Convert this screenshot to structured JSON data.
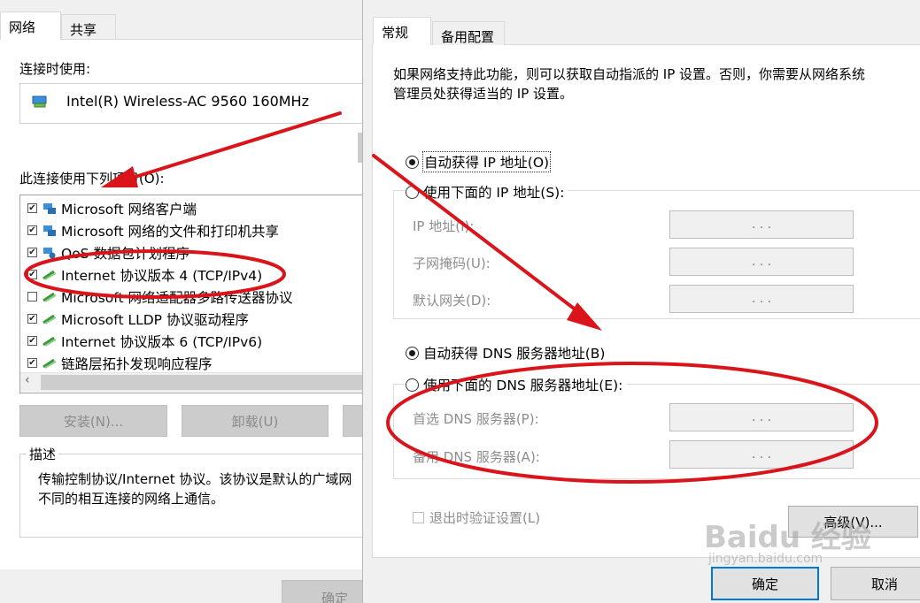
{
  "left_dialog": {
    "tabs": [
      "网络",
      "共享"
    ],
    "connect_using_label": "连接时使用:",
    "adapter_name": "Intel(R) Wireless-AC 9560 160MHz",
    "components_label": "此连接使用下列项目(O):",
    "components": [
      {
        "label": "Microsoft 网络客户端",
        "checked": true
      },
      {
        "label": "Microsoft 网络的文件和打印机共享",
        "checked": true
      },
      {
        "label": "QoS 数据包计划程序",
        "checked": true
      },
      {
        "label": "Internet 协议版本 4 (TCP/IPv4)",
        "checked": true
      },
      {
        "label": "Microsoft 网络适配器多路传送器协议",
        "checked": false
      },
      {
        "label": "Microsoft LLDP 协议驱动程序",
        "checked": true
      },
      {
        "label": "Internet 协议版本 6 (TCP/IPv6)",
        "checked": true
      },
      {
        "label": "链路层拓扑发现响应程序",
        "checked": true
      }
    ],
    "install_button": "安装(N)...",
    "uninstall_button": "卸载(U)",
    "description_title": "描述",
    "description_line1": "传输控制协议/Internet 协议。该协议是默认的广域网",
    "description_line2": "不同的相互连接的网络上通信。",
    "ok_button": "确定"
  },
  "right_dialog": {
    "tabs": [
      "常规",
      "备用配置"
    ],
    "info_line1": "如果网络支持此功能，则可以获取自动指派的 IP 设置。否则，你需要从网络系统",
    "info_line2": "管理员处获得适当的 IP 设置。",
    "auto_ip_radio": "自动获得 IP 地址(O)",
    "manual_ip_radio": "使用下面的 IP 地址(S):",
    "ip_address_label": "IP 地址(I):",
    "subnet_mask_label": "子网掩码(U):",
    "default_gateway_label": "默认网关(D):",
    "auto_dns_radio": "自动获得 DNS 服务器地址(B)",
    "manual_dns_radio": "使用下面的 DNS 服务器地址(E):",
    "preferred_dns_label": "首选 DNS 服务器(P):",
    "alternate_dns_label": "备用 DNS 服务器(A):",
    "ip_dots": ".     .     .",
    "validate_on_exit": "退出时验证设置(L)",
    "advanced_button": "高级(V)...",
    "ok_button": "确定",
    "cancel_button": "取消",
    "auto_ip_selected": true,
    "auto_dns_selected": true
  },
  "watermark": {
    "brand": "Baidu 经验",
    "url": "jingyan.baidu.com"
  },
  "colors": {
    "annotation_red": "#d9151b",
    "focus_blue": "#0078d7"
  }
}
